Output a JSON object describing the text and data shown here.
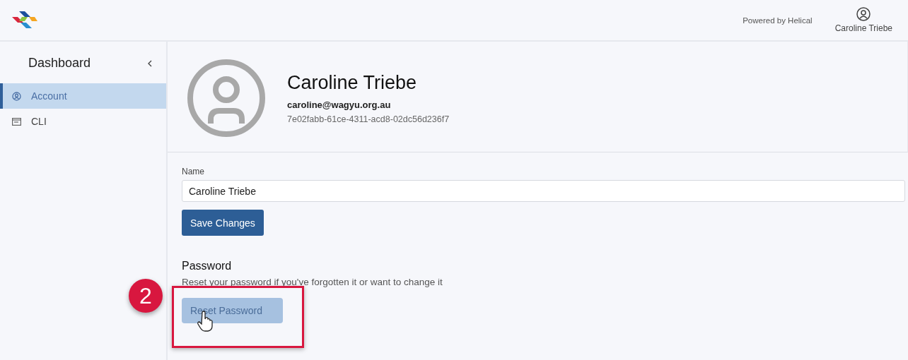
{
  "header": {
    "powered_by": "Powered by Helical",
    "user_name": "Caroline Triebe"
  },
  "sidebar": {
    "title": "Dashboard",
    "items": [
      {
        "label": "Account",
        "kind": "account",
        "selected": true
      },
      {
        "label": "CLI",
        "kind": "cli",
        "selected": false
      }
    ]
  },
  "profile": {
    "name": "Caroline Triebe",
    "email": "caroline@wagyu.org.au",
    "id": "7e02fabb-61ce-4311-acd8-02dc56d236f7"
  },
  "form": {
    "name_label": "Name",
    "name_value": "Caroline Triebe",
    "save_button": "Save Changes"
  },
  "password": {
    "heading": "Password",
    "description": "Reset your password if you've forgotten it or want to change it",
    "reset_button": "Reset Password",
    "disabled": true
  },
  "annotation": {
    "step": "2"
  }
}
